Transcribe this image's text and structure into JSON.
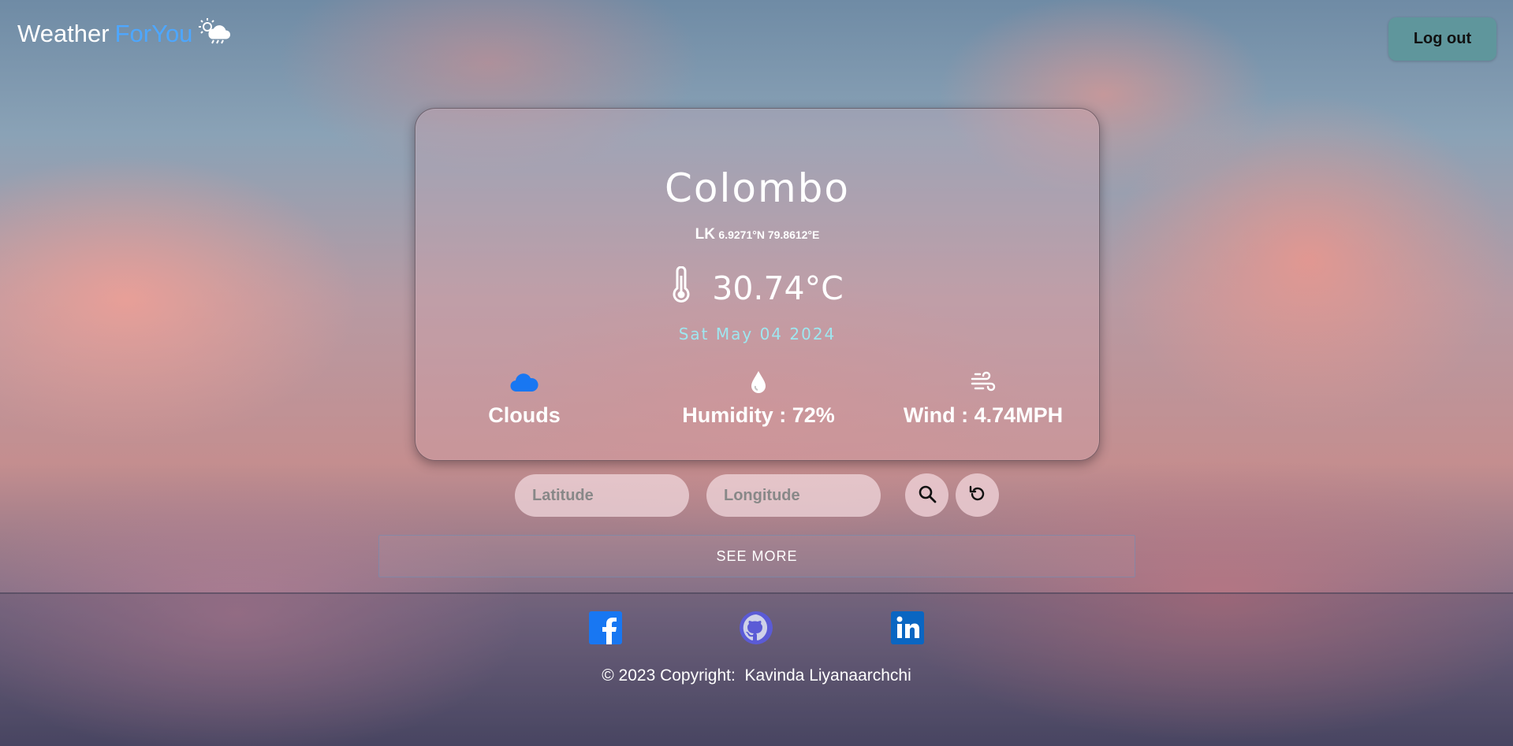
{
  "header": {
    "brand_weather": "Weather",
    "brand_foryou": "ForYou",
    "brand_icon": "sun-cloud-rain-icon",
    "logout_label": "Log out"
  },
  "weather": {
    "city": "Colombo",
    "country": "LK",
    "coordinates": "6.9271°N 79.8612°E",
    "temperature": "30.74°C",
    "date": "Sat May 04 2024",
    "condition": "Clouds",
    "humidity": "Humidity : 72%",
    "wind": "Wind : 4.74MPH",
    "icons": [
      "thermometer-icon",
      "cloud-icon",
      "droplet-icon",
      "wind-icon"
    ]
  },
  "search": {
    "latitude_placeholder": "Latitude",
    "longitude_placeholder": "Longitude",
    "search_icon": "search-icon",
    "reset_icon": "reset-icon"
  },
  "see_more_label": "SEE MORE",
  "footer": {
    "social": [
      "facebook-icon",
      "github-icon",
      "linkedin-icon"
    ],
    "copyright_prefix": "© 2023 Copyright:",
    "author": "Kavinda Liyanaarchchi"
  },
  "colors": {
    "brand_accent": "#4da7ff",
    "date_text": "#9ee7f0",
    "logout_button": "#5f969c",
    "cloud_icon": "#1877f2",
    "facebook": "#1877f2",
    "linkedin": "#0a66c2",
    "github": "#5b5bd6"
  }
}
